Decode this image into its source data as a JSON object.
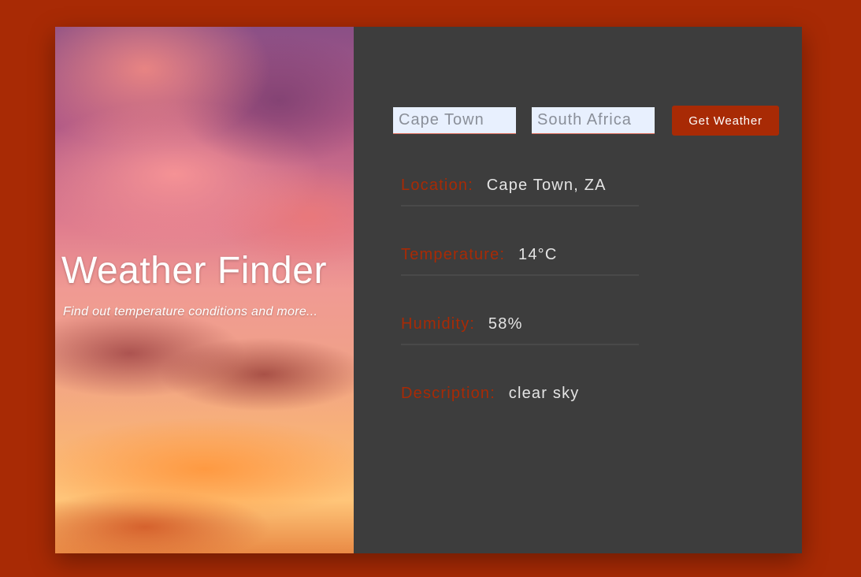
{
  "hero": {
    "title": "Weather Finder",
    "subtitle": "Find out temperature conditions and more..."
  },
  "form": {
    "city_value": "Cape Town",
    "country_value": "South Africa",
    "button_label": "Get Weather"
  },
  "results": {
    "location_label": "Location:",
    "location_value": "Cape Town, ZA",
    "temperature_label": "Temperature:",
    "temperature_value": "14°C",
    "humidity_label": "Humidity:",
    "humidity_value": "58%",
    "description_label": "Description:",
    "description_value": "clear sky"
  },
  "colors": {
    "background": "#a82a05",
    "panel": "#3d3d3d",
    "accent": "#a82a05",
    "value_text": "#e4e4e4",
    "input_bg": "#e8f0fe"
  }
}
